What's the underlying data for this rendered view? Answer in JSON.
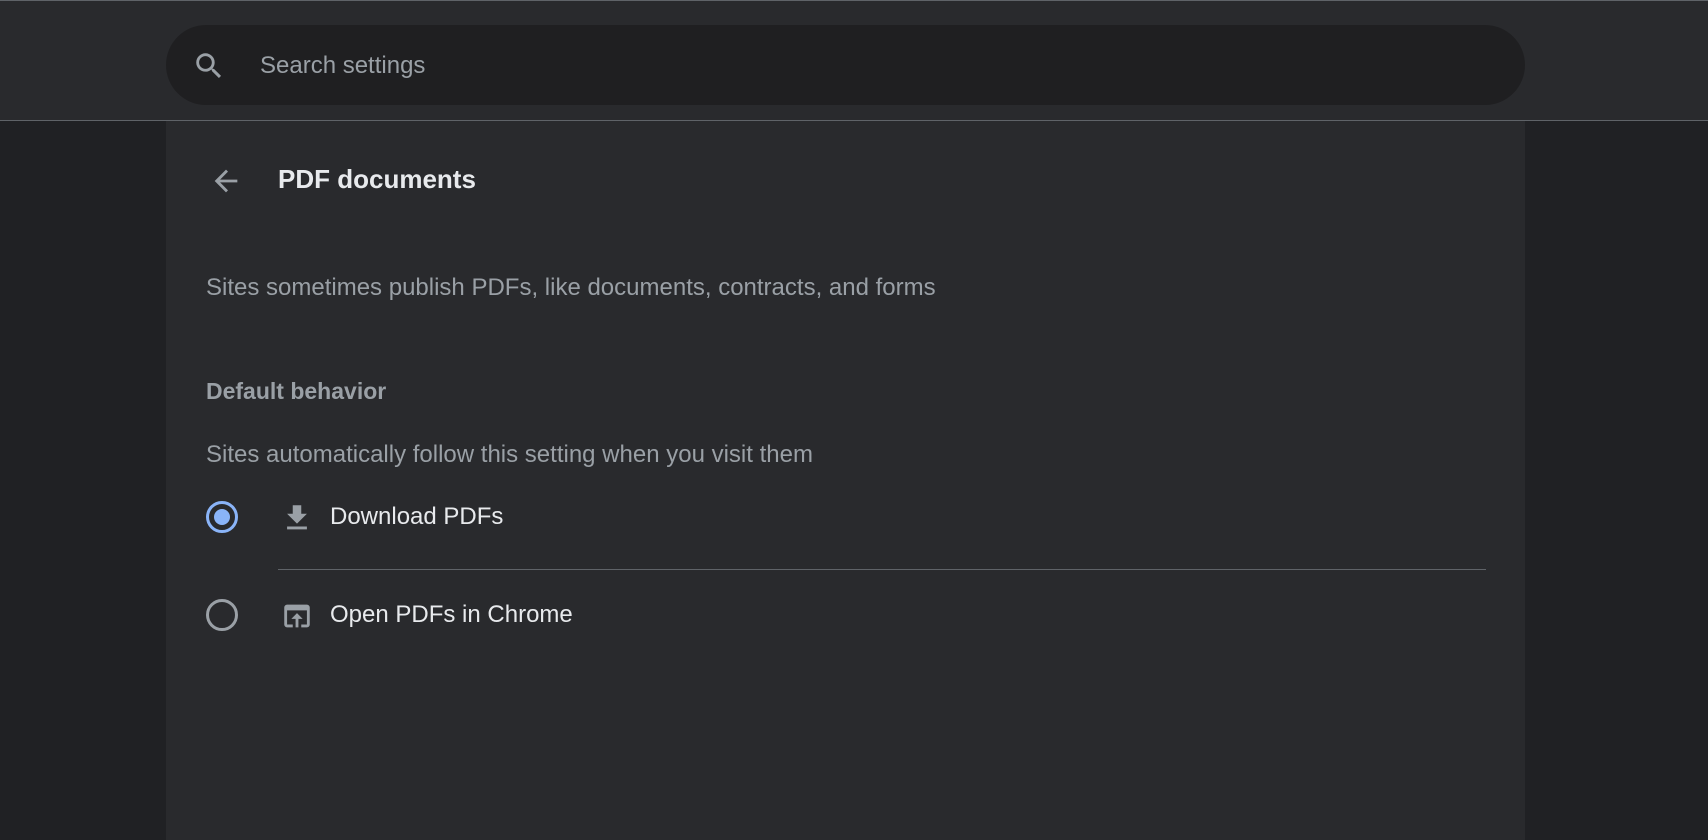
{
  "search": {
    "placeholder": "Search settings",
    "icon": "search-icon"
  },
  "page": {
    "title": "PDF documents",
    "back_icon": "arrow-back-icon",
    "description": "Sites sometimes publish PDFs, like documents, contracts, and forms"
  },
  "default_behavior": {
    "heading": "Default behavior",
    "subtitle": "Sites automatically follow this setting when you visit them",
    "options": [
      {
        "label": "Download PDFs",
        "icon": "download-icon",
        "selected": true
      },
      {
        "label": "Open PDFs in Chrome",
        "icon": "open-in-browser-icon",
        "selected": false
      }
    ]
  },
  "colors": {
    "accent": "#8ab4f8",
    "background": "#202124",
    "surface": "#292a2d",
    "text_primary": "#e8eaed",
    "text_secondary": "#9aa0a6"
  }
}
